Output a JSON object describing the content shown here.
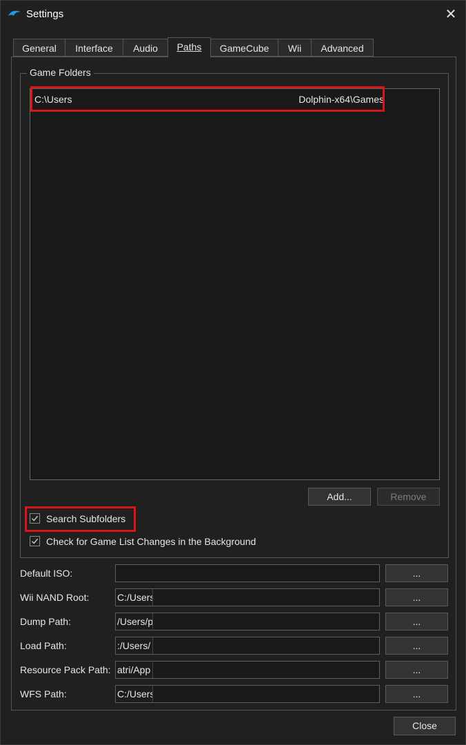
{
  "window": {
    "title": "Settings",
    "close_glyph": "✕",
    "icon": "dolphin-logo"
  },
  "tabs": [
    {
      "label": "General"
    },
    {
      "label": "Interface"
    },
    {
      "label": "Audio"
    },
    {
      "label": "Paths",
      "active": true
    },
    {
      "label": "GameCube"
    },
    {
      "label": "Wii"
    },
    {
      "label": "Advanced"
    }
  ],
  "game_folders": {
    "legend": "Game Folders",
    "items": [
      {
        "path_start": "C:\\Users",
        "path_end": "Dolphin-x64\\Games"
      }
    ],
    "add_label": "Add...",
    "remove_label": "Remove",
    "search_subfolders": {
      "label": "Search Subfolders",
      "checked": true
    },
    "check_changes": {
      "label": "Check for Game List Changes in the Background",
      "checked": true
    }
  },
  "paths": [
    {
      "label": "Default ISO:",
      "value": ""
    },
    {
      "label": "Wii NAND Root:",
      "value": "C:/Users"
    },
    {
      "label": "Dump Path:",
      "value": "/Users/p"
    },
    {
      "label": "Load Path:",
      "value": ":/Users/"
    },
    {
      "label": "Resource Pack Path:",
      "value": "atri/App"
    },
    {
      "label": "WFS Path:",
      "value": "C:/Users,"
    }
  ],
  "browse_label": "...",
  "footer": {
    "close_label": "Close"
  },
  "colors": {
    "highlight": "#d9141b",
    "accent": "#1e9ae0"
  }
}
